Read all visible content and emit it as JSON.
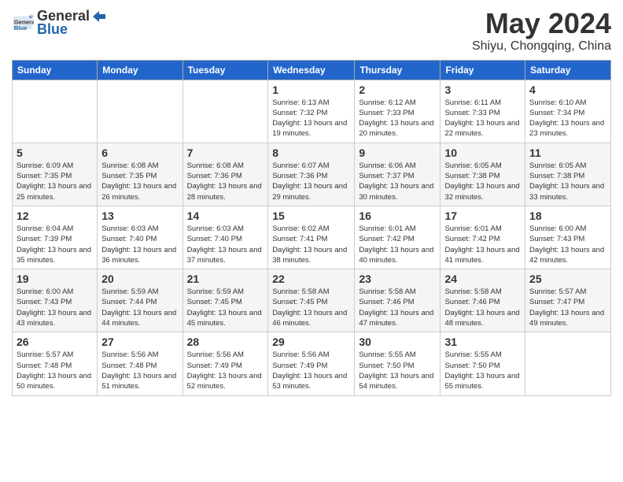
{
  "header": {
    "logo_general": "General",
    "logo_blue": "Blue",
    "month_title": "May 2024",
    "subtitle": "Shiyu, Chongqing, China"
  },
  "weekdays": [
    "Sunday",
    "Monday",
    "Tuesday",
    "Wednesday",
    "Thursday",
    "Friday",
    "Saturday"
  ],
  "weeks": [
    [
      {
        "day": "",
        "info": ""
      },
      {
        "day": "",
        "info": ""
      },
      {
        "day": "",
        "info": ""
      },
      {
        "day": "1",
        "info": "Sunrise: 6:13 AM\nSunset: 7:32 PM\nDaylight: 13 hours and 19 minutes."
      },
      {
        "day": "2",
        "info": "Sunrise: 6:12 AM\nSunset: 7:33 PM\nDaylight: 13 hours and 20 minutes."
      },
      {
        "day": "3",
        "info": "Sunrise: 6:11 AM\nSunset: 7:33 PM\nDaylight: 13 hours and 22 minutes."
      },
      {
        "day": "4",
        "info": "Sunrise: 6:10 AM\nSunset: 7:34 PM\nDaylight: 13 hours and 23 minutes."
      }
    ],
    [
      {
        "day": "5",
        "info": "Sunrise: 6:09 AM\nSunset: 7:35 PM\nDaylight: 13 hours and 25 minutes."
      },
      {
        "day": "6",
        "info": "Sunrise: 6:08 AM\nSunset: 7:35 PM\nDaylight: 13 hours and 26 minutes."
      },
      {
        "day": "7",
        "info": "Sunrise: 6:08 AM\nSunset: 7:36 PM\nDaylight: 13 hours and 28 minutes."
      },
      {
        "day": "8",
        "info": "Sunrise: 6:07 AM\nSunset: 7:36 PM\nDaylight: 13 hours and 29 minutes."
      },
      {
        "day": "9",
        "info": "Sunrise: 6:06 AM\nSunset: 7:37 PM\nDaylight: 13 hours and 30 minutes."
      },
      {
        "day": "10",
        "info": "Sunrise: 6:05 AM\nSunset: 7:38 PM\nDaylight: 13 hours and 32 minutes."
      },
      {
        "day": "11",
        "info": "Sunrise: 6:05 AM\nSunset: 7:38 PM\nDaylight: 13 hours and 33 minutes."
      }
    ],
    [
      {
        "day": "12",
        "info": "Sunrise: 6:04 AM\nSunset: 7:39 PM\nDaylight: 13 hours and 35 minutes."
      },
      {
        "day": "13",
        "info": "Sunrise: 6:03 AM\nSunset: 7:40 PM\nDaylight: 13 hours and 36 minutes."
      },
      {
        "day": "14",
        "info": "Sunrise: 6:03 AM\nSunset: 7:40 PM\nDaylight: 13 hours and 37 minutes."
      },
      {
        "day": "15",
        "info": "Sunrise: 6:02 AM\nSunset: 7:41 PM\nDaylight: 13 hours and 38 minutes."
      },
      {
        "day": "16",
        "info": "Sunrise: 6:01 AM\nSunset: 7:42 PM\nDaylight: 13 hours and 40 minutes."
      },
      {
        "day": "17",
        "info": "Sunrise: 6:01 AM\nSunset: 7:42 PM\nDaylight: 13 hours and 41 minutes."
      },
      {
        "day": "18",
        "info": "Sunrise: 6:00 AM\nSunset: 7:43 PM\nDaylight: 13 hours and 42 minutes."
      }
    ],
    [
      {
        "day": "19",
        "info": "Sunrise: 6:00 AM\nSunset: 7:43 PM\nDaylight: 13 hours and 43 minutes."
      },
      {
        "day": "20",
        "info": "Sunrise: 5:59 AM\nSunset: 7:44 PM\nDaylight: 13 hours and 44 minutes."
      },
      {
        "day": "21",
        "info": "Sunrise: 5:59 AM\nSunset: 7:45 PM\nDaylight: 13 hours and 45 minutes."
      },
      {
        "day": "22",
        "info": "Sunrise: 5:58 AM\nSunset: 7:45 PM\nDaylight: 13 hours and 46 minutes."
      },
      {
        "day": "23",
        "info": "Sunrise: 5:58 AM\nSunset: 7:46 PM\nDaylight: 13 hours and 47 minutes."
      },
      {
        "day": "24",
        "info": "Sunrise: 5:58 AM\nSunset: 7:46 PM\nDaylight: 13 hours and 48 minutes."
      },
      {
        "day": "25",
        "info": "Sunrise: 5:57 AM\nSunset: 7:47 PM\nDaylight: 13 hours and 49 minutes."
      }
    ],
    [
      {
        "day": "26",
        "info": "Sunrise: 5:57 AM\nSunset: 7:48 PM\nDaylight: 13 hours and 50 minutes."
      },
      {
        "day": "27",
        "info": "Sunrise: 5:56 AM\nSunset: 7:48 PM\nDaylight: 13 hours and 51 minutes."
      },
      {
        "day": "28",
        "info": "Sunrise: 5:56 AM\nSunset: 7:49 PM\nDaylight: 13 hours and 52 minutes."
      },
      {
        "day": "29",
        "info": "Sunrise: 5:56 AM\nSunset: 7:49 PM\nDaylight: 13 hours and 53 minutes."
      },
      {
        "day": "30",
        "info": "Sunrise: 5:55 AM\nSunset: 7:50 PM\nDaylight: 13 hours and 54 minutes."
      },
      {
        "day": "31",
        "info": "Sunrise: 5:55 AM\nSunset: 7:50 PM\nDaylight: 13 hours and 55 minutes."
      },
      {
        "day": "",
        "info": ""
      }
    ]
  ]
}
